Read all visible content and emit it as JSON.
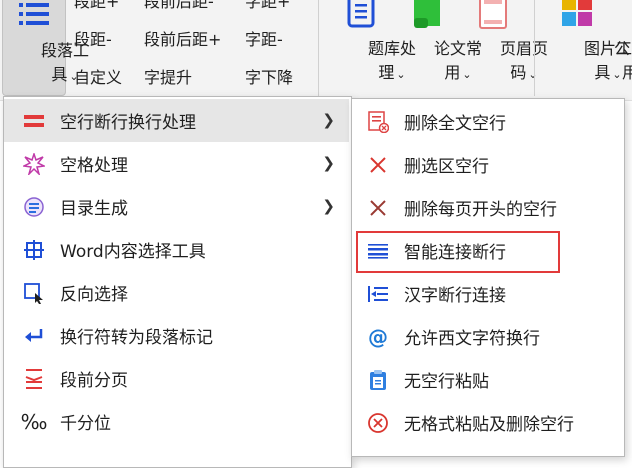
{
  "ribbon": {
    "paragraph_tool": {
      "line1": "段落工",
      "line2": "具"
    },
    "row1": [
      "段距+",
      "段前后距-",
      "字距+"
    ],
    "row2": [
      "段距-",
      "段前后距+",
      "字距-"
    ],
    "row3": [
      "自定义",
      "字提升",
      "字下降"
    ],
    "groups": [
      {
        "line1": "题库处",
        "line2": "理"
      },
      {
        "line1": "论文常",
        "line2": "用"
      },
      {
        "line1": "页眉页",
        "line2": "码"
      },
      {
        "line1": "图片工",
        "line2": "具"
      },
      {
        "line1": "公",
        "line2": "用"
      }
    ]
  },
  "main_menu": {
    "items": [
      {
        "label": "空行断行换行处理",
        "icon": "empty-line-icon",
        "has_submenu": true
      },
      {
        "label": "空格处理",
        "icon": "space-burst-icon",
        "has_submenu": true
      },
      {
        "label": "目录生成",
        "icon": "toc-icon",
        "has_submenu": true
      },
      {
        "label": "Word内容选择工具",
        "icon": "select-tool-icon",
        "has_submenu": false
      },
      {
        "label": "反向选择",
        "icon": "reverse-select-icon",
        "has_submenu": false
      },
      {
        "label": "换行符转为段落标记",
        "icon": "return-arrow-icon",
        "has_submenu": false
      },
      {
        "label": "段前分页",
        "icon": "page-break-icon",
        "has_submenu": false
      },
      {
        "label": "千分位",
        "icon": "per-mille-icon",
        "has_submenu": false
      }
    ]
  },
  "sub_menu": {
    "items": [
      {
        "label": "删除全文空行",
        "icon": "delete-doc-blank-icon"
      },
      {
        "label": "删选区空行",
        "icon": "x-red-icon"
      },
      {
        "label": "删除每页开头的空行",
        "icon": "x-dark-red-icon"
      },
      {
        "label": "智能连接断行",
        "icon": "smart-join-icon"
      },
      {
        "label": "汉字断行连接",
        "icon": "hanzi-join-icon"
      },
      {
        "label": "允许西文字符换行",
        "icon": "at-sign-icon"
      },
      {
        "label": "无空行粘贴",
        "icon": "clipboard-icon"
      },
      {
        "label": "无格式粘贴及删除空行",
        "icon": "no-format-paste-icon"
      }
    ]
  },
  "colors": {
    "accent_blue": "#1f4fd6",
    "accent_red": "#e23a3a"
  }
}
